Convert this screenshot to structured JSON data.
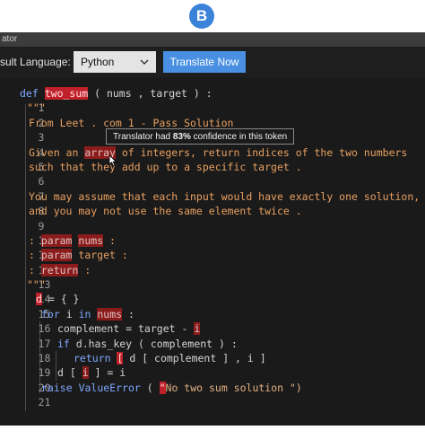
{
  "badge": {
    "letter": "B"
  },
  "window": {
    "title": "ator"
  },
  "toolbar": {
    "result_label": "sult",
    "language_label": "Language:",
    "language_value": "Python",
    "translate_label": "Translate Now"
  },
  "tooltip": {
    "prefix": "Translator had ",
    "percent": "83%",
    "suffix": " confidence in this token"
  },
  "code": {
    "line_numbers": [
      "1",
      "2",
      "3",
      "4",
      "5",
      "6",
      "7",
      "8",
      "9",
      "10",
      "11",
      "12",
      "13",
      "14",
      "15",
      "16",
      "17",
      "18",
      "19",
      "20",
      "21"
    ],
    "l1": {
      "def": "def",
      "fn": "two_sum",
      "rest": " ( nums , target ) :"
    },
    "l2": "\"\"\"",
    "l3": "From Leet . com 1 - Pass Solution",
    "l4": "",
    "l5": {
      "a": "Given an ",
      "hl": "array",
      "b": " of integers, return indices of the two numbers"
    },
    "l6": "such that they add up to a specific target .",
    "l7": "",
    "l8": "You may assume that each input would have exactly one solution,",
    "l9": "and you may not use the same element twice .",
    "l10": "",
    "l11": {
      "a": ": ",
      "hl1": "param",
      "b": " ",
      "hl2": "nums",
      "c": " :"
    },
    "l12": {
      "a": ": ",
      "hl1": "param",
      "b": " target :"
    },
    "l13": {
      "a": ": ",
      "hl1": "return",
      "b": " :"
    },
    "l14": "\"\"\"",
    "l15": {
      "hl": "d",
      "rest": " = { }"
    },
    "l16": {
      "kw1": "for",
      "a": " i ",
      "kw2": "in",
      "b": " ",
      "hl": "nums",
      "c": " :"
    },
    "l17": {
      "a": "complement = target - ",
      "hl": "i"
    },
    "l18": {
      "kw": "if",
      "a": " d.has_key ( complement ) :"
    },
    "l19": {
      "kw": "return",
      "a": " ",
      "hl": "[",
      "b": " d [ complement ] , i ]"
    },
    "l20": {
      "a": "d [ ",
      "hl": "i",
      "b": " ] = i"
    },
    "l21": {
      "kw": "raise",
      "a": " ",
      "err": "ValueError",
      "b": " ( ",
      "hl": "\"",
      "str": "No two sum solution \")"
    }
  }
}
